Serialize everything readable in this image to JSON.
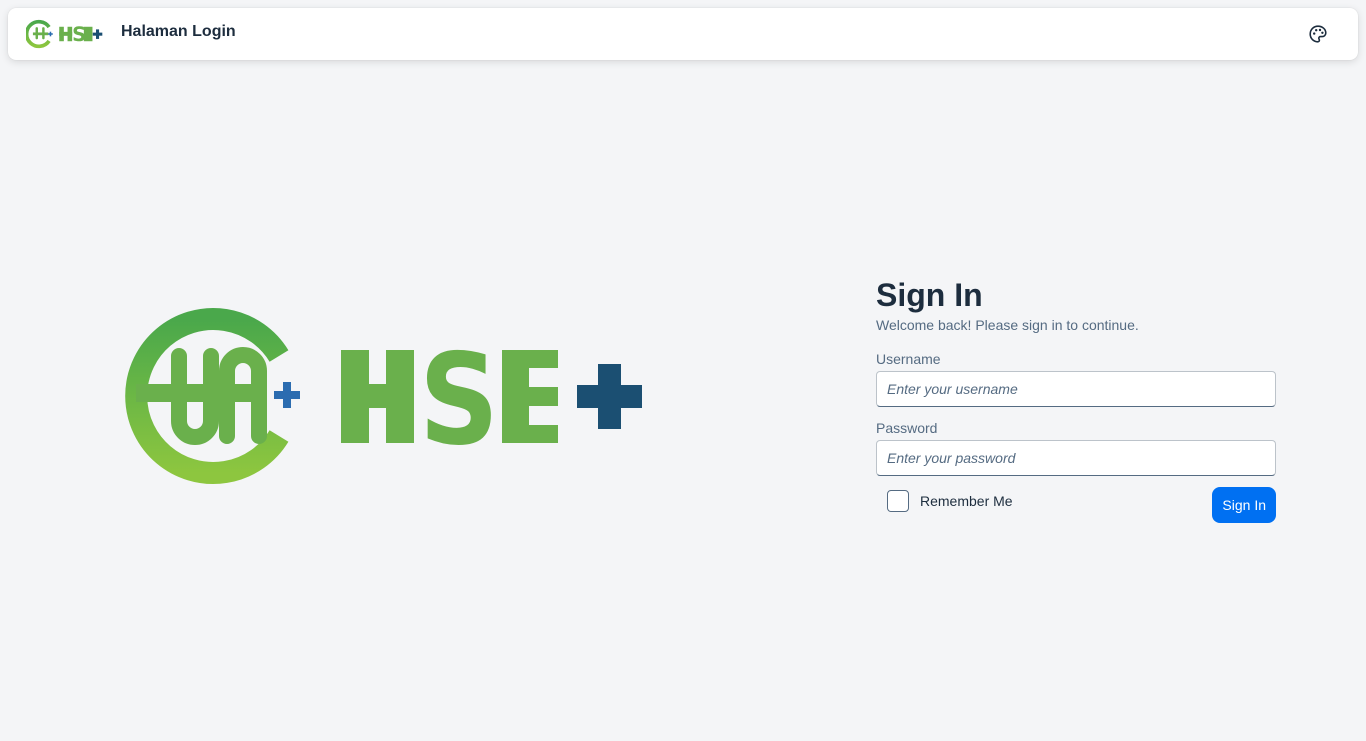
{
  "header": {
    "title": "Halaman Login",
    "logo_icon": "hse-plus-logo",
    "theme_icon": "palette-icon"
  },
  "brand": {
    "logo_text": "HSE+",
    "colors": {
      "green_start": "#4aa84b",
      "green_end": "#8dc63f",
      "plus": "#1b4f72",
      "small_plus": "#2b6cb0"
    }
  },
  "login": {
    "title": "Sign In",
    "subtitle": "Welcome back! Please sign in to continue.",
    "username_label": "Username",
    "username_placeholder": "Enter your username",
    "username_value": "",
    "password_label": "Password",
    "password_placeholder": "Enter your password",
    "password_value": "",
    "remember_label": "Remember Me",
    "remember_checked": false,
    "submit_label": "Sign In",
    "accent": "#0070f2"
  }
}
